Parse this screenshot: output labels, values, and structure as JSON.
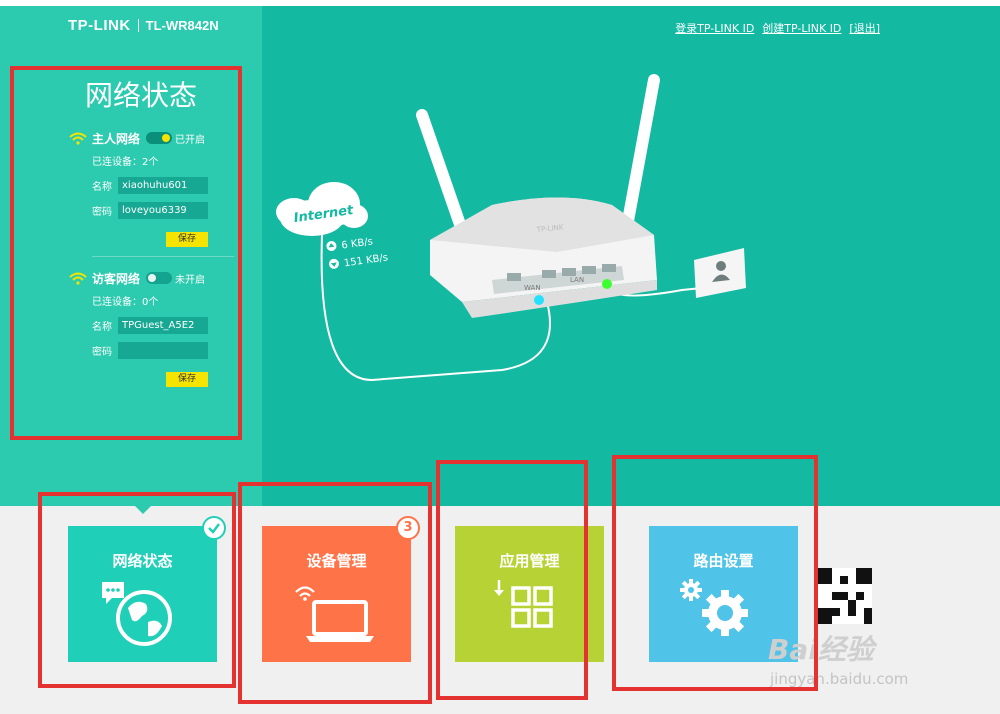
{
  "header": {
    "brand": "TP-LINK",
    "model": "TL-WR842N",
    "links": [
      "登录TP-LINK ID",
      "创建TP-LINK ID",
      "[退出]"
    ]
  },
  "status_panel": {
    "title": "网络状态",
    "host_network": {
      "name": "主人网络",
      "state": "已开启",
      "enabled": true,
      "connected": "已连设备：2个",
      "name_label": "名称",
      "ssid": "xiaohuhu601",
      "password_label": "密码",
      "password": "loveyou6339",
      "save": "保存"
    },
    "guest_network": {
      "name": "访客网络",
      "state": "未开启",
      "enabled": false,
      "connected": "已连设备：0个",
      "name_label": "名称",
      "ssid": "TPGuest_A5E2",
      "password_label": "密码",
      "password": "",
      "save": "保存"
    }
  },
  "diagram": {
    "internet": "Internet",
    "upload": "6 KB/s",
    "download": "151 KB/s",
    "wan": "WAN",
    "lan": "LAN",
    "router_brand": "TP-LINK"
  },
  "tiles": [
    {
      "label": "网络状态",
      "color": "#1fcfb7"
    },
    {
      "label": "设备管理",
      "color": "#ff7348",
      "badge": "3"
    },
    {
      "label": "应用管理",
      "color": "#b6d234"
    },
    {
      "label": "路由设置",
      "color": "#4fc3e8"
    }
  ],
  "watermark": {
    "logo": "Bai经验",
    "url": "jingyan.baidu.com"
  }
}
